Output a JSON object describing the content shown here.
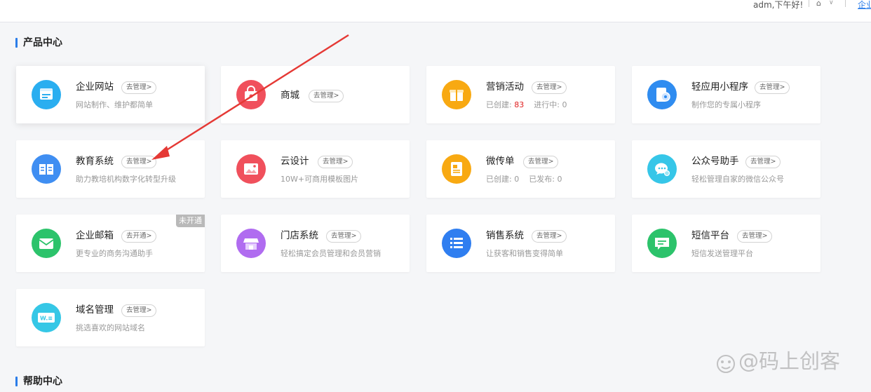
{
  "header": {
    "greeting": "adm,下午好!",
    "link_label": "企业"
  },
  "product_center": {
    "title": "产品中心",
    "cards": [
      {
        "name": "企业网站",
        "action": "去管理>",
        "desc": "网站制作、维护都简单",
        "color": "#2aaef0"
      },
      {
        "name": "商城",
        "action": "去管理>",
        "color": "#f0505c"
      },
      {
        "name": "营销活动",
        "action": "去管理>",
        "stat1_label": "已创建:",
        "stat1_value": "83",
        "stat2_label": "进行中:",
        "stat2_value": "0",
        "color": "#f8a912"
      },
      {
        "name": "轻应用小程序",
        "action": "去管理>",
        "desc": "制作您的专属小程序",
        "color": "#2f8cf0"
      },
      {
        "name": "教育系统",
        "action": "去管理>",
        "desc": "助力教培机构数字化转型升级",
        "color": "#3f8ef2"
      },
      {
        "name": "云设计",
        "action": "去管理>",
        "desc": "10W+可商用模板图片",
        "color": "#f0505c"
      },
      {
        "name": "微传单",
        "action": "去管理>",
        "stat1_label": "已创建:",
        "stat1_value": "0",
        "stat2_label": "已发布:",
        "stat2_value": "0",
        "color": "#f8a912"
      },
      {
        "name": "公众号助手",
        "action": "去管理>",
        "desc": "轻松管理自家的微信公众号",
        "color": "#36c6e8"
      },
      {
        "name": "企业邮箱",
        "action": "去开通>",
        "desc": "更专业的商务沟通助手",
        "ribbon": "未开通",
        "color": "#2cc36b"
      },
      {
        "name": "门店系统",
        "action": "去管理>",
        "desc": "轻松搞定会员管理和会员营销",
        "color": "#b06cf0"
      },
      {
        "name": "销售系统",
        "action": "去管理>",
        "desc": "让获客和销售变得简单",
        "color": "#2f7ef0"
      },
      {
        "name": "短信平台",
        "action": "去管理>",
        "desc": "短信发送管理平台",
        "color": "#2cc36b"
      },
      {
        "name": "域名管理",
        "action": "去管理>",
        "desc": "挑选喜欢的网站域名",
        "color": "#35c7e6",
        "icon_text": "W.≡"
      }
    ]
  },
  "help_center": {
    "title": "帮助中心"
  },
  "watermark": "@码上创客",
  "icons": {
    "header": [
      "user-menu-icon",
      "chevron-down-icon"
    ],
    "cards": [
      "website-icon",
      "shop-bag-icon",
      "gift-icon",
      "mini-program-icon",
      "book-icon",
      "image-icon",
      "flyer-icon",
      "wechat-icon",
      "mail-icon",
      "store-icon",
      "list-icon",
      "message-icon",
      "domain-icon"
    ]
  }
}
